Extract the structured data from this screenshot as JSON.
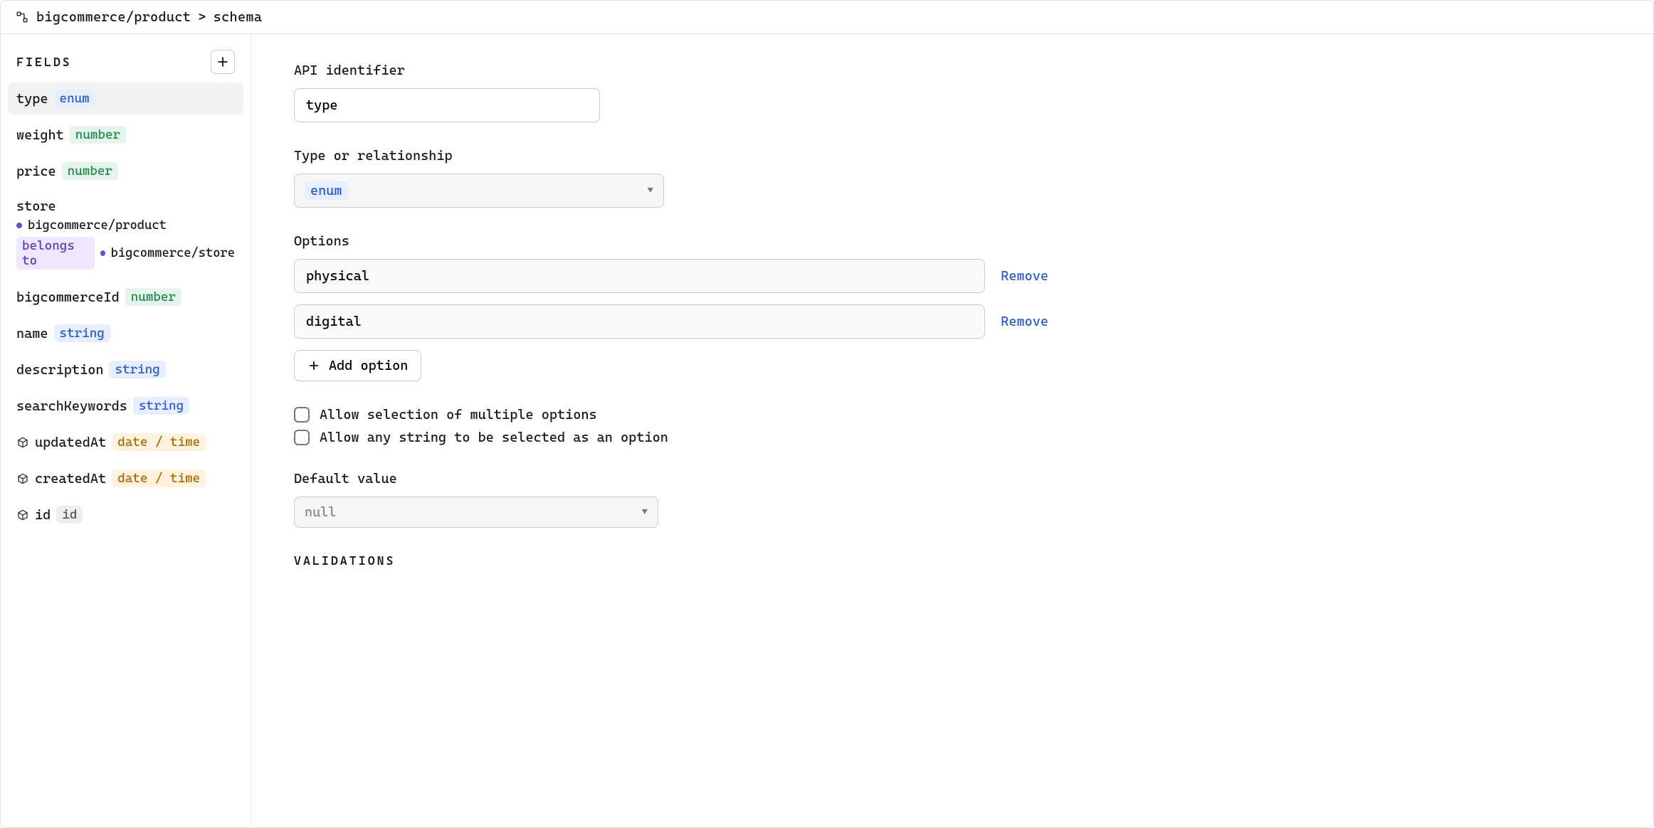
{
  "breadcrumb": {
    "model": "bigcommerce/product",
    "sep": ">",
    "page": "schema"
  },
  "sidebar": {
    "title": "FIELDS",
    "fields": [
      {
        "name": "type",
        "badge": "enum",
        "badgeClass": "badge-enum",
        "active": true
      },
      {
        "name": "weight",
        "badge": "number",
        "badgeClass": "badge-number"
      },
      {
        "name": "price",
        "badge": "number",
        "badgeClass": "badge-number"
      },
      {
        "name": "store",
        "rel": {
          "from": "bigcommerce/product",
          "label": "belongs to",
          "to": "bigcommerce/store"
        }
      },
      {
        "name": "bigcommerceId",
        "badge": "number",
        "badgeClass": "badge-number"
      },
      {
        "name": "name",
        "badge": "string",
        "badgeClass": "badge-string"
      },
      {
        "name": "description",
        "badge": "string",
        "badgeClass": "badge-string"
      },
      {
        "name": "searchKeywords",
        "badge": "string",
        "badgeClass": "badge-string"
      },
      {
        "name": "updatedAt",
        "badge": "date / time",
        "badgeClass": "badge-date",
        "icon": "cube"
      },
      {
        "name": "createdAt",
        "badge": "date / time",
        "badgeClass": "badge-date",
        "icon": "cube"
      },
      {
        "name": "id",
        "badge": "id",
        "badgeClass": "badge-id",
        "icon": "cube"
      }
    ]
  },
  "form": {
    "apiIdentifier": {
      "label": "API identifier",
      "value": "type"
    },
    "typeRel": {
      "label": "Type or relationship",
      "selected": "enum"
    },
    "options": {
      "label": "Options",
      "items": [
        {
          "value": "physical",
          "remove": "Remove"
        },
        {
          "value": "digital",
          "remove": "Remove"
        }
      ],
      "addLabel": "Add option"
    },
    "checkboxes": {
      "multi": "Allow selection of multiple options",
      "any": "Allow any string to be selected as an option"
    },
    "defaultValue": {
      "label": "Default value",
      "selected": "null"
    },
    "validationsHeading": "VALIDATIONS"
  }
}
